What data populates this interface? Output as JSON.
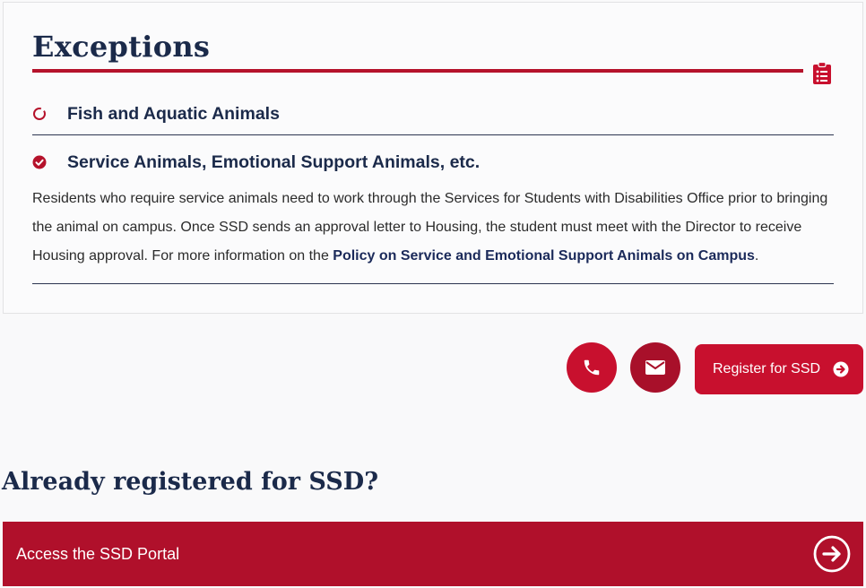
{
  "card": {
    "title": "Exceptions",
    "icon": "clipboard-list-icon",
    "items": [
      {
        "label": "Fish and Aquatic Animals",
        "state": "collapsed",
        "icon": "circle-outline-icon"
      },
      {
        "label": "Service Animals, Emotional Support Animals, etc.",
        "state": "expanded",
        "icon": "check-circle-icon"
      }
    ],
    "body": {
      "text": "Residents who require service animals need to work through the Services for Students with Disabilities Office prior to bringing the animal on campus. Once SSD sends an approval letter to Housing, the student must meet with the Director to receive Housing approval. For more information on the ",
      "link": "Policy on Service and Emotional Support Animals on Campus",
      "after": "."
    }
  },
  "actions": {
    "phone_icon": "phone-icon",
    "mail_icon": "envelope-icon",
    "register_label": "Register for SSD",
    "register_icon": "arrow-circle-right-icon"
  },
  "registered": {
    "heading": "Already registered for SSD?",
    "portal_label": "Access the SSD Portal",
    "portal_icon": "arrow-circle-right-icon"
  },
  "colors": {
    "brand_red": "#c8102e",
    "dark_red": "#b0102b",
    "navy": "#1b2a4a"
  }
}
